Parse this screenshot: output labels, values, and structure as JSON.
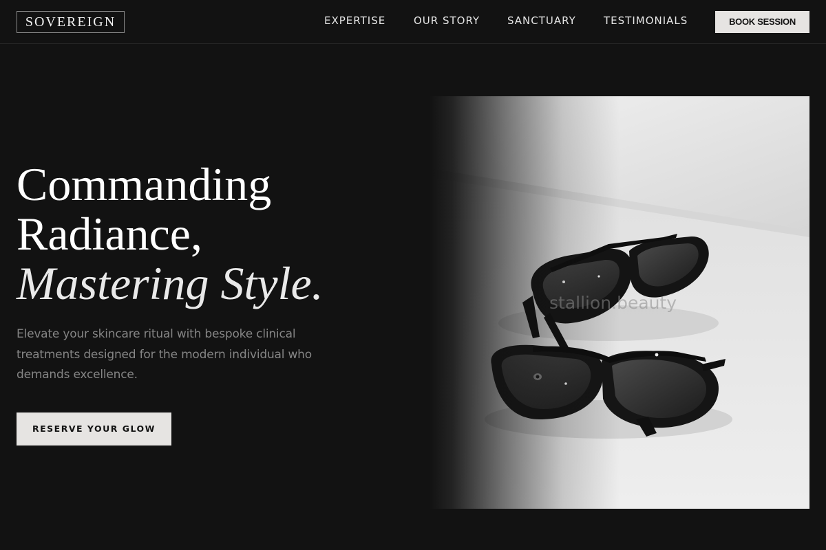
{
  "header": {
    "logo": "SOVEREIGN",
    "nav": [
      "EXPERTISE",
      "OUR STORY",
      "SANCTUARY",
      "TESTIMONIALS"
    ],
    "cta_label": "BOOK SESSION"
  },
  "hero": {
    "headline_line1": "Commanding",
    "headline_line2": "Radiance,",
    "headline_line3": "Mastering Style.",
    "subtext": "Elevate your skincare ritual with bespoke clinical treatments designed for the modern individual who demands excellence.",
    "cta_label": "RESERVE YOUR GLOW",
    "image": {
      "subject": "two pairs of dark protective glasses on a white surface",
      "watermark": "stallion.beauty"
    }
  },
  "colors": {
    "background": "#121212",
    "text_primary": "#ffffff",
    "text_muted": "#858585",
    "button_bg": "#e6e4e2",
    "button_text": "#121212"
  }
}
